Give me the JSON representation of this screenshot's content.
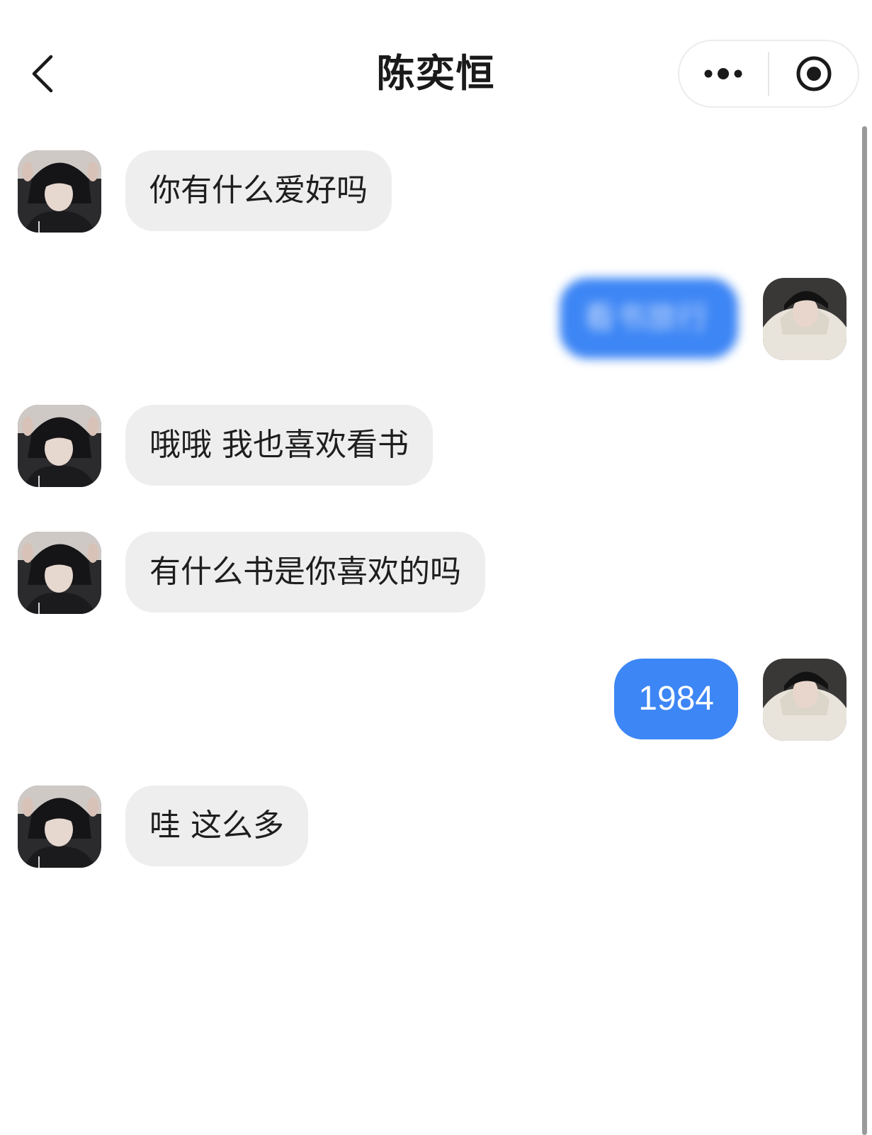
{
  "header": {
    "title": "陈奕恒",
    "back_icon": "chevron-left-icon",
    "more_icon": "more-dots-icon",
    "close_icon": "target-circle-icon"
  },
  "colors": {
    "incoming_bubble": "#eeeeee",
    "outgoing_bubble": "#3d86f5",
    "outgoing_text": "#ffffff"
  },
  "messages": [
    {
      "side": "left",
      "text": "你有什么爱好吗"
    },
    {
      "side": "right",
      "text": "看书旅行",
      "blurred": true
    },
    {
      "side": "left",
      "text": "哦哦 我也喜欢看书"
    },
    {
      "side": "left",
      "text": "有什么书是你喜欢的吗"
    },
    {
      "side": "right",
      "text": "1984"
    },
    {
      "side": "left",
      "text": "哇 这么多"
    }
  ]
}
